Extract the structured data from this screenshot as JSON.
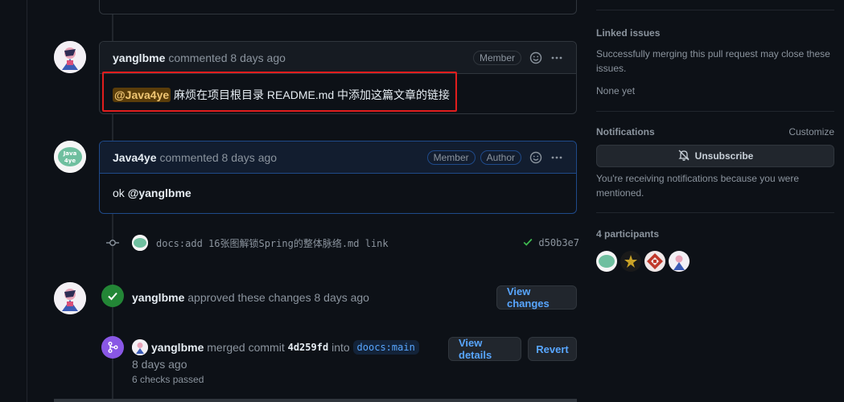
{
  "timeline": {
    "comment1": {
      "author": "yanglbme",
      "meta": "commented 8 days ago",
      "badge": "Member",
      "body_mention": "@Java4ye",
      "body_text": " 麻烦在项目根目录 README.md 中添加这篇文章的链接"
    },
    "comment2": {
      "author": "Java4ye",
      "meta": "commented 8 days ago",
      "badge_member": "Member",
      "badge_author": "Author",
      "body_prefix": "ok ",
      "body_mention": "@yanglbme"
    },
    "commit": {
      "message": "docs:add 16张图解锁Spring的整体脉络.md link",
      "sha": "d50b3e7"
    },
    "approval": {
      "actor": "yanglbme",
      "text": " approved these changes 8 days ago",
      "button": "View changes"
    },
    "merge": {
      "actor": "yanglbme",
      "text_before": " merged commit ",
      "commit_sha": "4d259fd",
      "text_into": " into ",
      "branch": "doocs:main",
      "time": "8 days ago",
      "checks": "6 checks passed",
      "btn_details": "View details",
      "btn_revert": "Revert"
    }
  },
  "sidebar": {
    "linked_issues": {
      "title": "Linked issues",
      "desc": "Successfully merging this pull request may close these issues.",
      "value": "None yet"
    },
    "notifications": {
      "title": "Notifications",
      "customize": "Customize",
      "button": "Unsubscribe",
      "desc": "You're receiving notifications because you were mentioned."
    },
    "participants": {
      "title": "4 participants"
    }
  },
  "colors": {
    "background": "#0d1117",
    "accent": "#58a6ff",
    "approved": "#238636",
    "merged": "#8957e5",
    "highlight": "#e11d1d"
  }
}
